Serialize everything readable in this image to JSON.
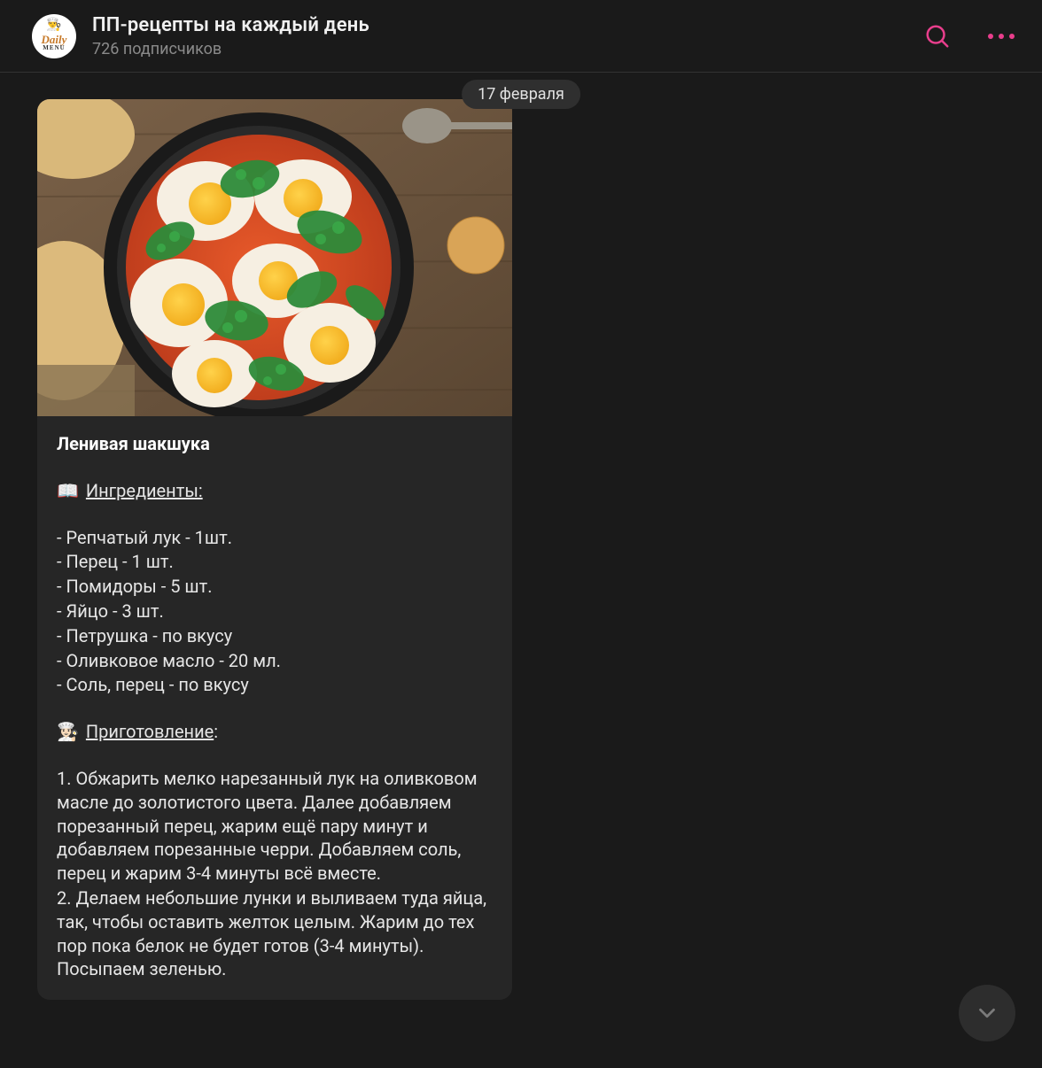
{
  "header": {
    "channel_title": "ПП-рецепты на каждый день",
    "subscribers": "726 подписчиков",
    "avatar_text": "Daily",
    "avatar_subtext": "MENU"
  },
  "date_chip": "17 февраля",
  "message": {
    "title": "Ленивая шакшука",
    "ingredients_emoji": "📖",
    "ingredients_label": "Ингредиенты:",
    "ingredients": [
      "- Репчатый лук - 1шт.",
      "- Перец - 1 шт.",
      "- Помидоры - 5 шт.",
      "- Яйцо  - 3 шт.",
      "- Петрушка - по вкусу",
      "- Оливковое масло - 20 мл.",
      "- Соль, перец - по вкусу"
    ],
    "prep_emoji": "👩🏻‍🍳",
    "prep_label": "Приготовление",
    "prep_colon": ":",
    "steps": [
      "1. Обжарить мелко нарезанный лук на оливковом масле до золотистого цвета. Далее добавляем порезанный перец, жарим ещё пару минут и добавляем порезанные черри. Добавляем соль, перец и жарим 3-4 минуты всё вместе.",
      "2. Делаем небольшие лунки и выливаем туда яйца, так, чтобы оставить желток целым. Жарим до тех пор пока белок не будет готов (3-4 минуты). Посыпаем зеленью."
    ]
  }
}
